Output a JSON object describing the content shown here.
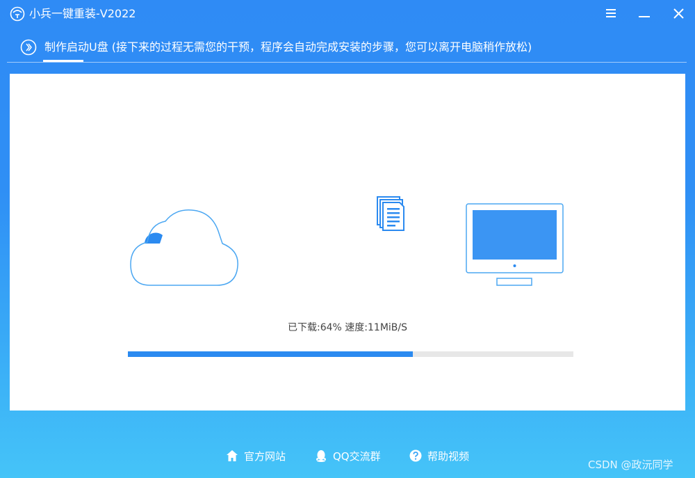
{
  "window": {
    "title": "小兵一键重装-V2022",
    "logo_icon": "soldier-logo-icon",
    "controls": [
      {
        "name": "menu-button",
        "icon": "menu-icon"
      },
      {
        "name": "minimize-button",
        "icon": "minimize-icon"
      },
      {
        "name": "close-button",
        "icon": "close-icon"
      }
    ]
  },
  "step": {
    "icon": "chevron-right-circle-icon",
    "text": "制作启动U盘 (接下来的过程无需您的干预，程序会自动完成安装的步骤，您可以离开电脑稍作放松)"
  },
  "download": {
    "status_text": "已下载:64% 速度:11MiB/S",
    "progress": 0.64,
    "icons": [
      "cloud-icon",
      "document-icon",
      "monitor-icon"
    ]
  },
  "footer": {
    "links": [
      {
        "label": "官方网站",
        "icon": "home-icon"
      },
      {
        "label": "QQ交流群",
        "icon": "qq-penguin-icon"
      },
      {
        "label": "帮助视频",
        "icon": "help-circle-icon"
      }
    ]
  },
  "watermark": "CSDN @政沅同学",
  "colors": {
    "accent": "#2b8af0",
    "background_top": "#2f8bf5",
    "background_bottom": "#45c4f8",
    "progress_track": "#e7e7e7"
  }
}
